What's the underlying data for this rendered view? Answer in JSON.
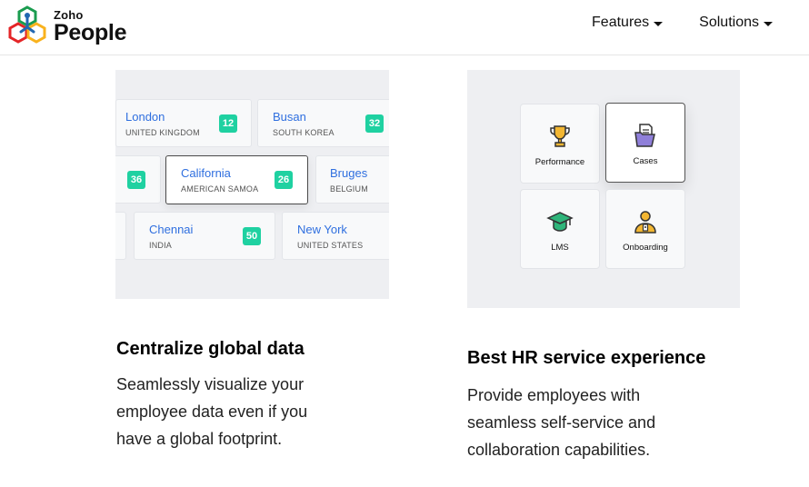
{
  "header": {
    "brand_top": "Zoho",
    "brand_main": "People",
    "nav": [
      {
        "label": "Features",
        "icon": "caret-down-icon"
      },
      {
        "label": "Solutions",
        "icon": "caret-down-icon"
      }
    ]
  },
  "left_feature": {
    "cities": [
      {
        "name": "London",
        "country": "UNITED KINGDOM",
        "count": "12"
      },
      {
        "name": "Busan",
        "country": "SOUTH KOREA",
        "count": "32"
      },
      {
        "name": "",
        "country": "",
        "count": "36"
      },
      {
        "name": "California",
        "country": "AMERICAN SAMOA",
        "count": "26"
      },
      {
        "name": "Bruges",
        "country": "BELGIUM",
        "count": ""
      },
      {
        "name": "Chennai",
        "country": "INDIA",
        "count": "50"
      },
      {
        "name": "New York",
        "country": "UNITED STATES",
        "count": ""
      }
    ],
    "title": "Centralize global data",
    "body_lines": [
      "Seamlessly visualize your",
      "employee data even if you",
      "have a global footprint."
    ]
  },
  "right_feature": {
    "tiles": [
      {
        "label": "Performance",
        "icon": "trophy-icon"
      },
      {
        "label": "Cases",
        "icon": "folder-document-icon"
      },
      {
        "label": "LMS",
        "icon": "graduation-cap-icon"
      },
      {
        "label": "Onboarding",
        "icon": "employee-id-icon"
      }
    ],
    "title": "Best HR service experience",
    "body_lines": [
      "Provide employees with",
      "seamless self-service and",
      "collaboration capabilities."
    ]
  },
  "colors": {
    "city_link": "#2f6fdf",
    "badge": "#1fd1a1",
    "panel_bg": "#eeeff2"
  }
}
